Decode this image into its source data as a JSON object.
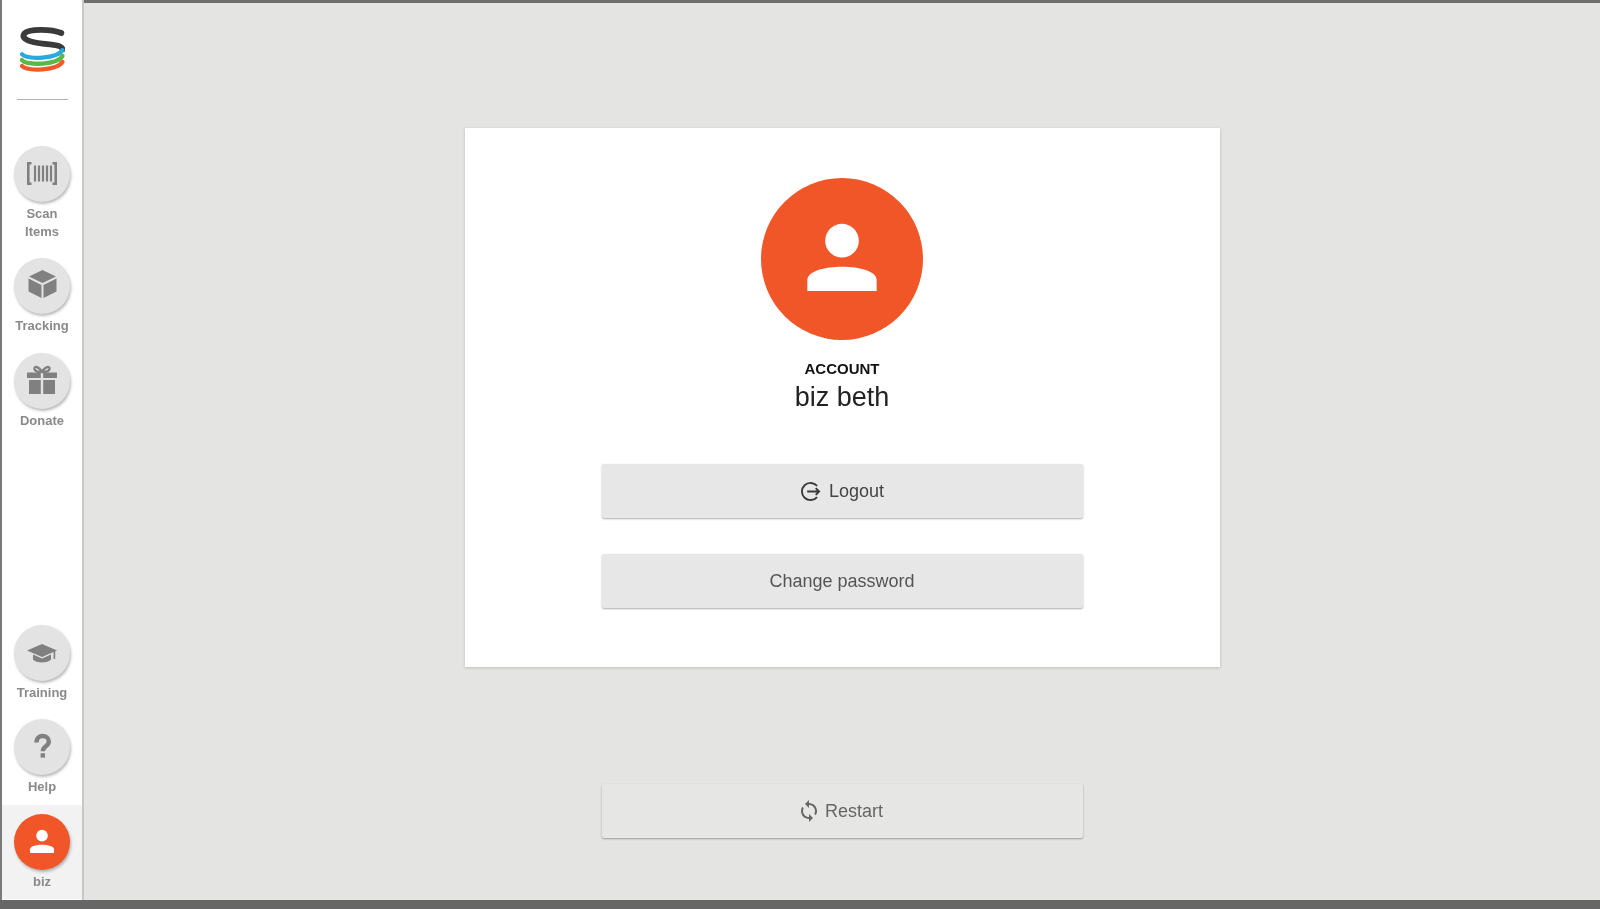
{
  "sidebar": {
    "nav_items": [
      {
        "label": "Scan Items",
        "selected": false
      },
      {
        "label": "Tracking",
        "selected": false
      },
      {
        "label": "Donate",
        "selected": false
      }
    ],
    "footer_items": [
      {
        "label": "Training",
        "selected": false
      },
      {
        "label": "Help",
        "selected": false
      },
      {
        "label": "biz",
        "selected": true
      }
    ]
  },
  "account_card": {
    "heading": "ACCOUNT",
    "name": "biz beth",
    "logout_button": "Logout",
    "change_password_button": "Change password"
  },
  "restart_button": "Restart"
}
